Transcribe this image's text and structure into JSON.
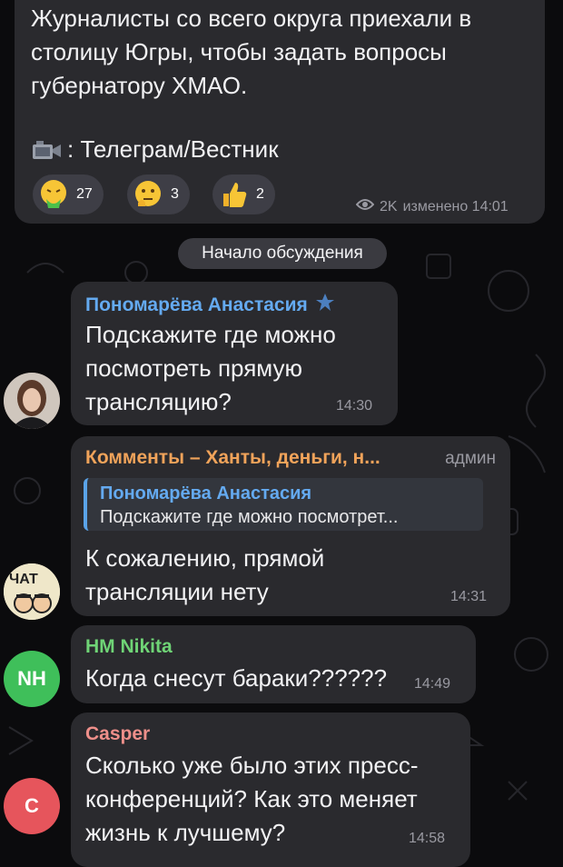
{
  "channel_post": {
    "text_lines": [
      "Журналисты со всего округа приехали в",
      "столицу Югры, чтобы задать вопросы",
      "губернатору ХМАО."
    ],
    "credit": ": Телеграм/Вестник",
    "reactions": [
      {
        "icon": "nauseated-face-emoji",
        "count": "27"
      },
      {
        "icon": "thinking-face-emoji",
        "count": "3"
      },
      {
        "icon": "thumbs-up-emoji",
        "count": "2"
      }
    ],
    "views": "2K",
    "edited_time": "изменено 14:01"
  },
  "divider": {
    "label": "Начало обсуждения"
  },
  "messages": [
    {
      "author": "Пономарёва Анастасия",
      "author_color": "#64aaf0",
      "lines": [
        "Подскажите где можно",
        "посмотреть прямую",
        "трансляцию?"
      ],
      "time": "14:30"
    },
    {
      "author": "Комменты – Ханты, деньги, н...",
      "author_color": "#f0a35a",
      "role": "админ",
      "reply": {
        "name": "Пономарёва Анастасия",
        "text": "Подскажите где можно посмотрет..."
      },
      "lines": [
        "К сожалению, прямой",
        "трансляции нету"
      ],
      "time": "14:31",
      "avatar_text": "ЧАТ"
    },
    {
      "author": "HM Nikita",
      "author_color": "#6fd476",
      "lines": [
        "Когда снесут бараки??????"
      ],
      "time": "14:49",
      "avatar_text": "NH",
      "avatar_color": "#3fbf5a"
    },
    {
      "author": "Casper",
      "author_color": "#ee8f8a",
      "lines": [
        "Сколько уже было этих пресс-",
        "конференций? Как это меняет",
        "жизнь к лучшему?"
      ],
      "time": "14:58",
      "avatar_text": "C",
      "avatar_color": "#e6555c"
    }
  ]
}
